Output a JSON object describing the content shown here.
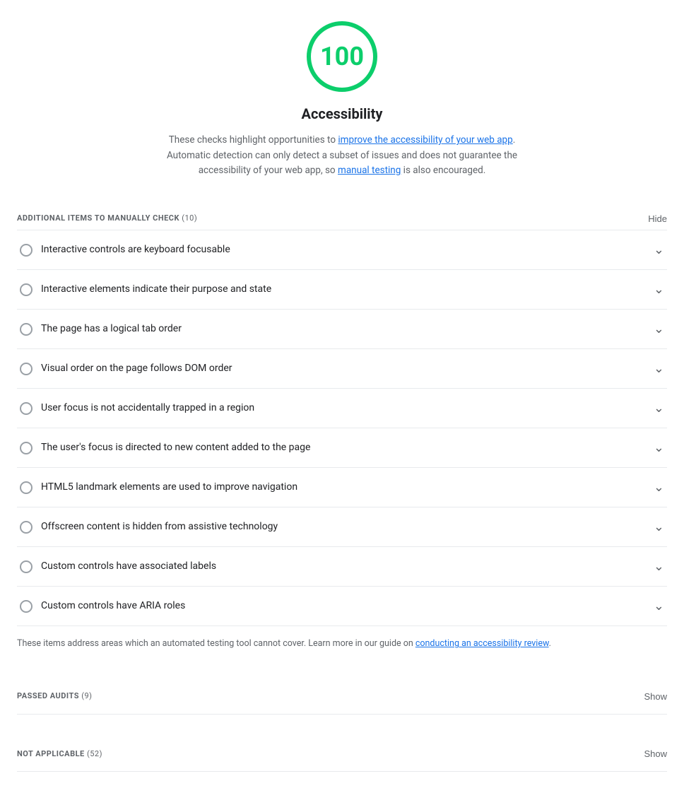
{
  "score": {
    "value": "100",
    "label": "Accessibility"
  },
  "description": {
    "text_before": "These checks highlight opportunities to ",
    "link1_text": "improve the accessibility of your web app",
    "link1_url": "#",
    "text_middle": ". Automatic detection can only detect a subset of issues and does not guarantee the accessibility of your web app, so ",
    "link2_text": "manual testing",
    "link2_url": "#",
    "text_after": " is also encouraged."
  },
  "additional_items": {
    "label": "ADDITIONAL ITEMS TO MANUALLY CHECK",
    "count": "(10)",
    "hide_label": "Hide",
    "items": [
      {
        "label": "Interactive controls are keyboard focusable"
      },
      {
        "label": "Interactive elements indicate their purpose and state"
      },
      {
        "label": "The page has a logical tab order"
      },
      {
        "label": "Visual order on the page follows DOM order"
      },
      {
        "label": "User focus is not accidentally trapped in a region"
      },
      {
        "label": "The user's focus is directed to new content added to the page"
      },
      {
        "label": "HTML5 landmark elements are used to improve navigation"
      },
      {
        "label": "Offscreen content is hidden from assistive technology"
      },
      {
        "label": "Custom controls have associated labels"
      },
      {
        "label": "Custom controls have ARIA roles"
      }
    ],
    "footer_text_before": "These items address areas which an automated testing tool cannot cover. Learn more in our guide on ",
    "footer_link_text": "conducting an accessibility review",
    "footer_link_url": "#",
    "footer_text_after": "."
  },
  "passed_audits": {
    "label": "PASSED AUDITS",
    "count": "(9)",
    "show_label": "Show"
  },
  "not_applicable": {
    "label": "NOT APPLICABLE",
    "count": "(52)",
    "show_label": "Show"
  }
}
